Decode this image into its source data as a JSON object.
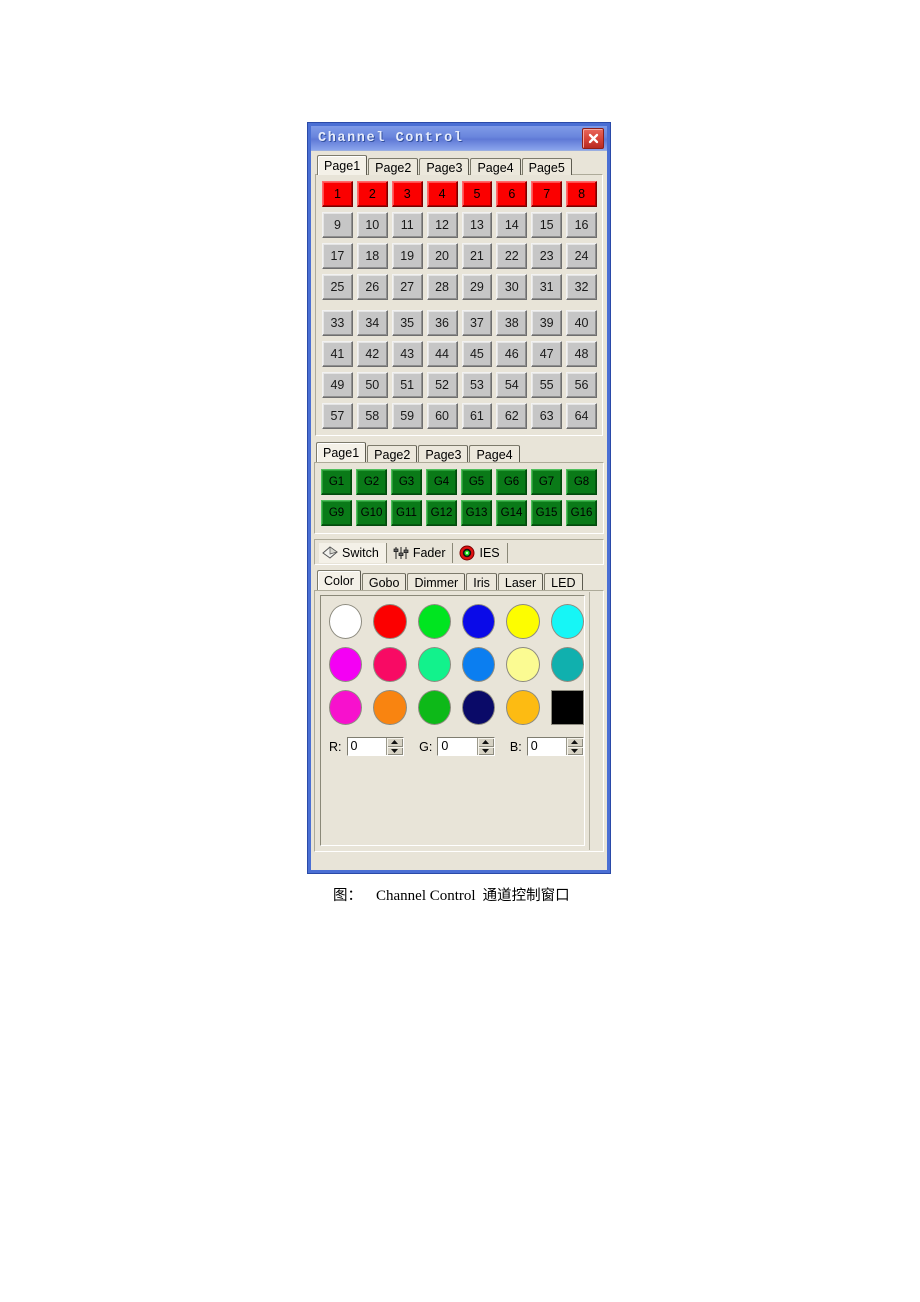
{
  "window": {
    "title": "Channel Control",
    "close_label": "✕",
    "close_icon": "close-icon"
  },
  "channel_section": {
    "tabs": [
      {
        "label": "Page1",
        "active": true
      },
      {
        "label": "Page2",
        "active": false
      },
      {
        "label": "Page3",
        "active": false
      },
      {
        "label": "Page4",
        "active": false
      },
      {
        "label": "Page5",
        "active": false
      }
    ],
    "rows": [
      {
        "cells": [
          "1",
          "2",
          "3",
          "4",
          "5",
          "6",
          "7",
          "8"
        ],
        "selected": true
      },
      {
        "cells": [
          "9",
          "10",
          "11",
          "12",
          "13",
          "14",
          "15",
          "16"
        ],
        "selected": false
      },
      {
        "cells": [
          "17",
          "18",
          "19",
          "20",
          "21",
          "22",
          "23",
          "24"
        ],
        "selected": false
      },
      {
        "cells": [
          "25",
          "26",
          "27",
          "28",
          "29",
          "30",
          "31",
          "32"
        ],
        "selected": false
      },
      {
        "cells": [
          "33",
          "34",
          "35",
          "36",
          "37",
          "38",
          "39",
          "40"
        ],
        "selected": false
      },
      {
        "cells": [
          "41",
          "42",
          "43",
          "44",
          "45",
          "46",
          "47",
          "48"
        ],
        "selected": false
      },
      {
        "cells": [
          "49",
          "50",
          "51",
          "52",
          "53",
          "54",
          "55",
          "56"
        ],
        "selected": false
      },
      {
        "cells": [
          "57",
          "58",
          "59",
          "60",
          "61",
          "62",
          "63",
          "64"
        ],
        "selected": false
      }
    ],
    "selected_color": "#fb0000",
    "unselected_color": "#c6c6c6"
  },
  "group_section": {
    "tabs": [
      {
        "label": "Page1",
        "active": true
      },
      {
        "label": "Page2",
        "active": false
      },
      {
        "label": "Page3",
        "active": false
      },
      {
        "label": "Page4",
        "active": false
      }
    ],
    "rows": [
      {
        "cells": [
          "G1",
          "G2",
          "G3",
          "G4",
          "G5",
          "G6",
          "G7",
          "G8"
        ]
      },
      {
        "cells": [
          "G9",
          "G10",
          "G11",
          "G12",
          "G13",
          "G14",
          "G15",
          "G16"
        ]
      }
    ],
    "button_color": "#0a7a18"
  },
  "mode_bar": {
    "items": [
      {
        "label": "Switch",
        "icon": "diamond-icon",
        "active": true
      },
      {
        "label": "Fader",
        "icon": "fader-sliders-icon",
        "active": false
      },
      {
        "label": "IES",
        "icon": "ies-target-icon",
        "active": false
      }
    ]
  },
  "attribute_tabs": [
    {
      "label": "Color",
      "active": true
    },
    {
      "label": "Gobo",
      "active": false
    },
    {
      "label": "Dimmer",
      "active": false
    },
    {
      "label": "Iris",
      "active": false
    },
    {
      "label": "Laser",
      "active": false
    },
    {
      "label": "LED",
      "active": false
    }
  ],
  "color_palette": {
    "rows": [
      [
        {
          "name": "white",
          "hex": "#ffffff",
          "shape": "circle"
        },
        {
          "name": "red",
          "hex": "#fc0000",
          "shape": "circle"
        },
        {
          "name": "green",
          "hex": "#00e520",
          "shape": "circle"
        },
        {
          "name": "blue",
          "hex": "#0a0ae8",
          "shape": "circle"
        },
        {
          "name": "yellow",
          "hex": "#fdfd00",
          "shape": "circle"
        },
        {
          "name": "cyan",
          "hex": "#16f6f6",
          "shape": "circle"
        }
      ],
      [
        {
          "name": "magenta",
          "hex": "#f400f4",
          "shape": "circle"
        },
        {
          "name": "deep-pink",
          "hex": "#f80a64",
          "shape": "circle"
        },
        {
          "name": "spring-green",
          "hex": "#12f28c",
          "shape": "circle"
        },
        {
          "name": "dodger-blue",
          "hex": "#0b7ef0",
          "shape": "circle"
        },
        {
          "name": "light-yellow",
          "hex": "#fbfb92",
          "shape": "circle"
        },
        {
          "name": "teal",
          "hex": "#10b0ae",
          "shape": "circle"
        }
      ],
      [
        {
          "name": "hot-magenta",
          "hex": "#f711cd",
          "shape": "circle"
        },
        {
          "name": "orange",
          "hex": "#f98410",
          "shape": "circle"
        },
        {
          "name": "emerald",
          "hex": "#0db918",
          "shape": "circle"
        },
        {
          "name": "navy",
          "hex": "#0a0a68",
          "shape": "circle"
        },
        {
          "name": "amber",
          "hex": "#fdbb12",
          "shape": "circle"
        },
        {
          "name": "black",
          "hex": "#000000",
          "shape": "square"
        }
      ]
    ]
  },
  "rgb_inputs": [
    {
      "label": "R:",
      "value": "0"
    },
    {
      "label": "G:",
      "value": "0"
    },
    {
      "label": "B:",
      "value": "0"
    }
  ],
  "caption": {
    "prefix": "图：",
    "title": "Channel Control",
    "suffix": "通道控制窗口"
  }
}
